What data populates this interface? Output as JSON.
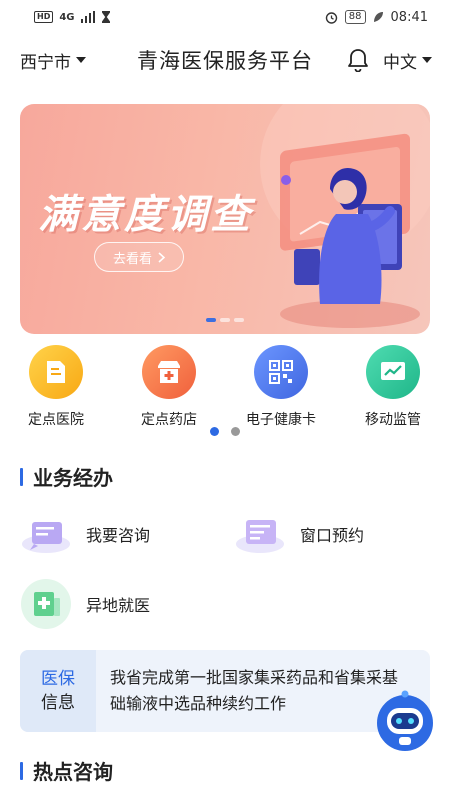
{
  "status_bar": {
    "left_hd": "HD",
    "left_net": "4G",
    "battery": "88",
    "time": "08:41"
  },
  "header": {
    "city": "西宁市",
    "title": "青海医保服务平台",
    "language": "中文",
    "icons": [
      "bell-icon",
      "chevron-down-icon"
    ]
  },
  "banner": {
    "title": "满意度调查",
    "button_label": "去看看",
    "slide_count": 3,
    "active_slide": 0,
    "colors": {
      "bg": "#f7a89c",
      "accent": "#3d6fe0"
    }
  },
  "quick_menu": {
    "items": [
      {
        "label": "定点医院",
        "icon": "hospital-icon",
        "color": "#fbbb1c"
      },
      {
        "label": "定点药店",
        "icon": "pharmacy-icon",
        "color": "#f7794c"
      },
      {
        "label": "电子健康卡",
        "icon": "qr-card-icon",
        "color": "#4f7df0"
      },
      {
        "label": "移动监管",
        "icon": "chart-icon",
        "color": "#2dc39a"
      }
    ],
    "page_count": 2,
    "active_page": 0
  },
  "business": {
    "title": "业务经办",
    "items": [
      {
        "label": "我要咨询",
        "icon": "consult-icon"
      },
      {
        "label": "窗口预约",
        "icon": "appointment-icon"
      },
      {
        "label": "异地就医",
        "icon": "remote-medical-icon"
      }
    ]
  },
  "news": {
    "tag_line1": "医保",
    "tag_line2": "信息",
    "text": "我省完成第一批国家集采药品和省集采基础输液中选品种续约工作"
  },
  "hot": {
    "title": "热点咨询"
  },
  "colors": {
    "primary": "#2d6ae3"
  }
}
